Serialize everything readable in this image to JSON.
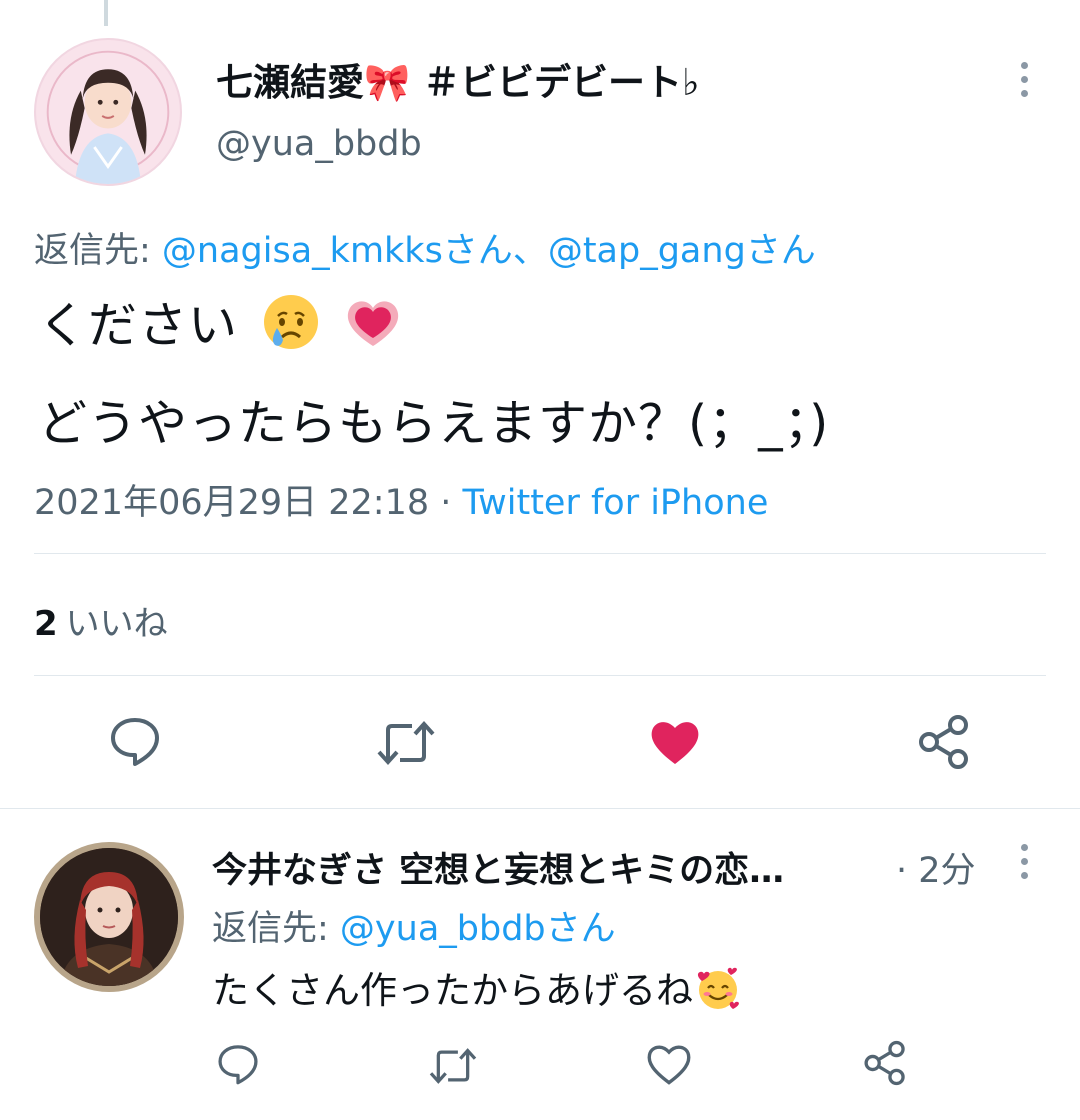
{
  "main_tweet": {
    "display_name": "七瀬結愛🎀 ＃ビビデビート♭",
    "handle": "@yua_bbdb",
    "reply_to_prefix": "返信先: ",
    "reply_to_user1": "@nagisa_kmkksさん",
    "reply_to_sep": "、",
    "reply_to_user2": "@tap_gangさん",
    "body_line1": "ください",
    "body_line2": "どうやったらもらえますか？(；_；)",
    "timestamp": "2021年06月29日 22:18",
    "meta_sep": " · ",
    "client": "Twitter for iPhone",
    "like_count": "2",
    "like_label": "いいね",
    "liked": true,
    "colors": {
      "like_active": "#e0245e",
      "link": "#1d9bf0",
      "muted": "#536471"
    }
  },
  "reply_tweet": {
    "display_name": "今井なぎさ 空想と妄想とキミの恋…",
    "time": "· 2分",
    "reply_to_prefix": "返信先: ",
    "reply_to_user": "@yua_bbdbさん",
    "body": "たくさん作ったからあげるね",
    "liked": false
  },
  "icons": [
    "more-vertical-icon",
    "reply-icon",
    "retweet-icon",
    "like-icon",
    "share-icon",
    "crying-face-emoji",
    "pink-heart-emoji",
    "smiling-hearts-emoji"
  ]
}
